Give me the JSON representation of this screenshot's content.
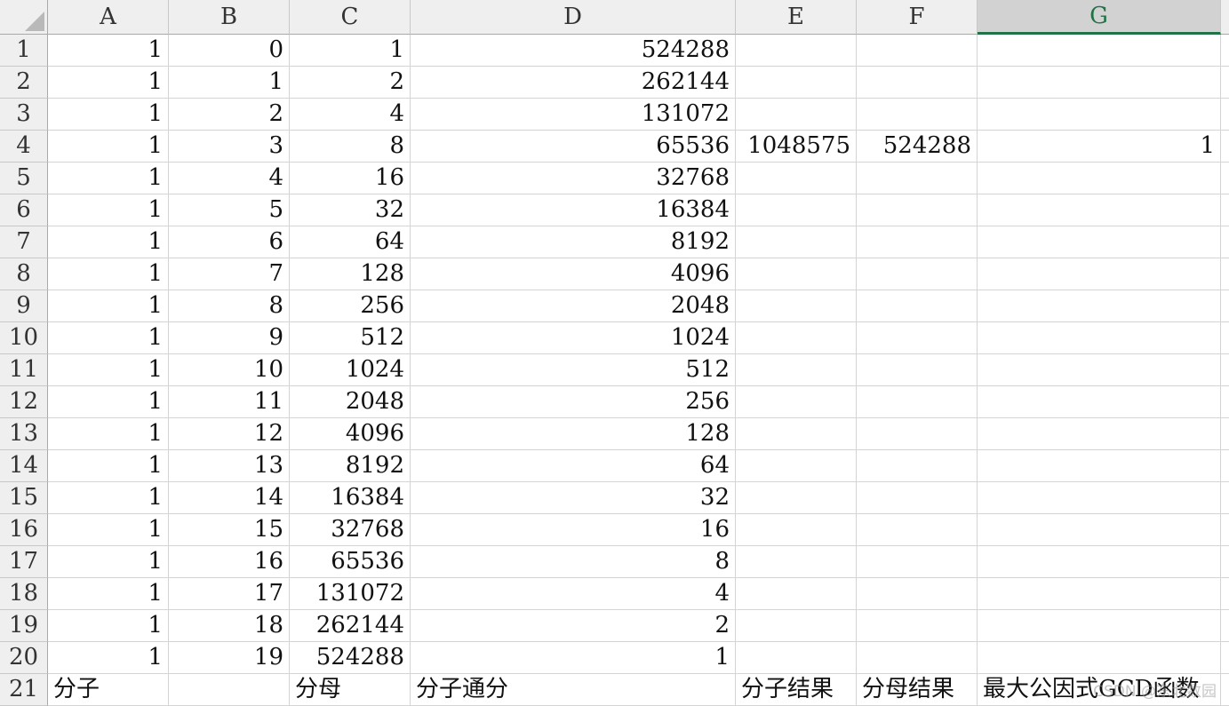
{
  "columns": [
    "A",
    "B",
    "C",
    "D",
    "E",
    "F",
    "G"
  ],
  "selected_column": "G",
  "rows": [
    {
      "n": "1",
      "A": "1",
      "B": "0",
      "C": "1",
      "D": "524288",
      "E": "",
      "F": "",
      "G": ""
    },
    {
      "n": "2",
      "A": "1",
      "B": "1",
      "C": "2",
      "D": "262144",
      "E": "",
      "F": "",
      "G": ""
    },
    {
      "n": "3",
      "A": "1",
      "B": "2",
      "C": "4",
      "D": "131072",
      "E": "",
      "F": "",
      "G": ""
    },
    {
      "n": "4",
      "A": "1",
      "B": "3",
      "C": "8",
      "D": "65536",
      "E": "1048575",
      "F": "524288",
      "G": "1"
    },
    {
      "n": "5",
      "A": "1",
      "B": "4",
      "C": "16",
      "D": "32768",
      "E": "",
      "F": "",
      "G": ""
    },
    {
      "n": "6",
      "A": "1",
      "B": "5",
      "C": "32",
      "D": "16384",
      "E": "",
      "F": "",
      "G": ""
    },
    {
      "n": "7",
      "A": "1",
      "B": "6",
      "C": "64",
      "D": "8192",
      "E": "",
      "F": "",
      "G": ""
    },
    {
      "n": "8",
      "A": "1",
      "B": "7",
      "C": "128",
      "D": "4096",
      "E": "",
      "F": "",
      "G": ""
    },
    {
      "n": "9",
      "A": "1",
      "B": "8",
      "C": "256",
      "D": "2048",
      "E": "",
      "F": "",
      "G": ""
    },
    {
      "n": "10",
      "A": "1",
      "B": "9",
      "C": "512",
      "D": "1024",
      "E": "",
      "F": "",
      "G": ""
    },
    {
      "n": "11",
      "A": "1",
      "B": "10",
      "C": "1024",
      "D": "512",
      "E": "",
      "F": "",
      "G": ""
    },
    {
      "n": "12",
      "A": "1",
      "B": "11",
      "C": "2048",
      "D": "256",
      "E": "",
      "F": "",
      "G": ""
    },
    {
      "n": "13",
      "A": "1",
      "B": "12",
      "C": "4096",
      "D": "128",
      "E": "",
      "F": "",
      "G": ""
    },
    {
      "n": "14",
      "A": "1",
      "B": "13",
      "C": "8192",
      "D": "64",
      "E": "",
      "F": "",
      "G": ""
    },
    {
      "n": "15",
      "A": "1",
      "B": "14",
      "C": "16384",
      "D": "32",
      "E": "",
      "F": "",
      "G": ""
    },
    {
      "n": "16",
      "A": "1",
      "B": "15",
      "C": "32768",
      "D": "16",
      "E": "",
      "F": "",
      "G": ""
    },
    {
      "n": "17",
      "A": "1",
      "B": "16",
      "C": "65536",
      "D": "8",
      "E": "",
      "F": "",
      "G": ""
    },
    {
      "n": "18",
      "A": "1",
      "B": "17",
      "C": "131072",
      "D": "4",
      "E": "",
      "F": "",
      "G": ""
    },
    {
      "n": "19",
      "A": "1",
      "B": "18",
      "C": "262144",
      "D": "2",
      "E": "",
      "F": "",
      "G": ""
    },
    {
      "n": "20",
      "A": "1",
      "B": "19",
      "C": "524288",
      "D": "1",
      "E": "",
      "F": "",
      "G": ""
    },
    {
      "n": "21",
      "A": "分子",
      "B": "",
      "C": "分母",
      "D": "分子通分",
      "E": "分子结果",
      "F": "分母结果",
      "G": "最大公因式GCD函数"
    }
  ],
  "watermark": "CSDN @东北数园"
}
